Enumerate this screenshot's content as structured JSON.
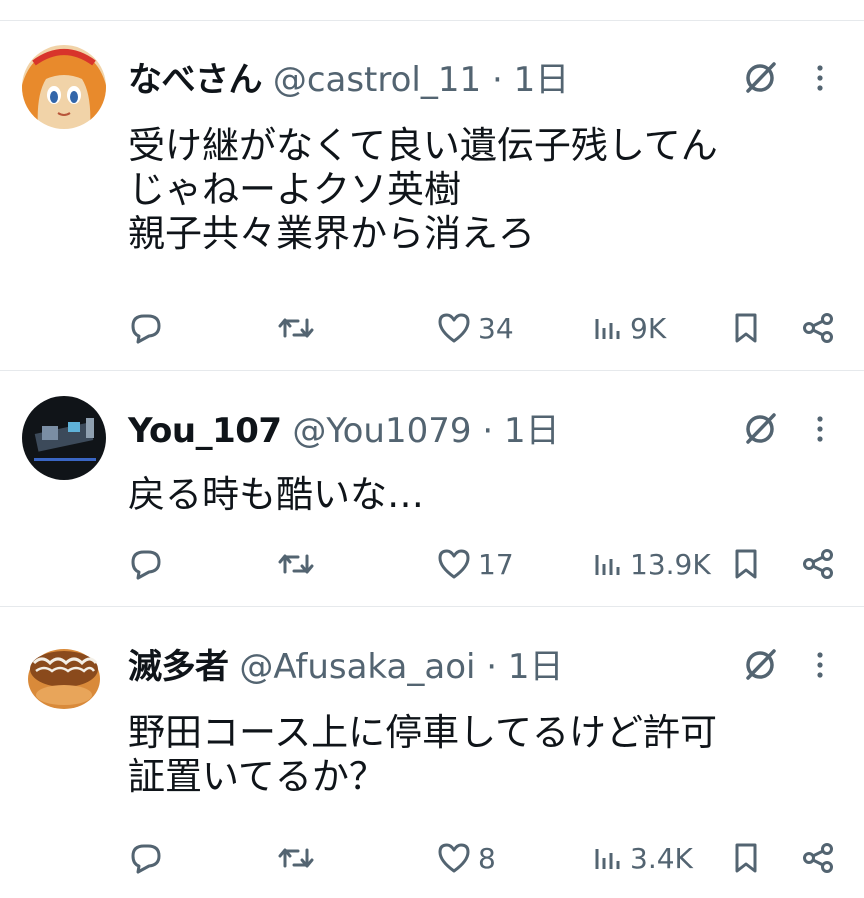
{
  "tweets": [
    {
      "name": "なべさん",
      "handle": "@castrol_11",
      "separator": "·",
      "time": "1日",
      "lines": [
        "受け継がなくて良い遺伝子残してん",
        "じゃねーよクソ英樹",
        "親子共々業界から消えろ"
      ],
      "likes": "34",
      "views": "9K"
    },
    {
      "name": "You_107",
      "handle": "@You1079",
      "separator": "·",
      "time": "1日",
      "lines": [
        "戻る時も酷いな…"
      ],
      "likes": "17",
      "views": "13.9K"
    },
    {
      "name": "滅多者",
      "handle": "@Afusaka_aoi",
      "separator": "·",
      "time": "1日",
      "lines": [
        "野田コース上に停車してるけど許可",
        "証置いてるか？"
      ],
      "likes": "8",
      "views": "3.4K"
    }
  ],
  "icons": {
    "reply": "reply-icon",
    "retweet": "retweet-icon",
    "like": "heart-icon",
    "views": "views-icon",
    "bookmark": "bookmark-icon",
    "share": "share-icon",
    "grok": "grok-icon",
    "more": "more-icon"
  },
  "colors": {
    "text": "#0f1419",
    "muted": "#536471",
    "divider": "#e6e9ec"
  }
}
